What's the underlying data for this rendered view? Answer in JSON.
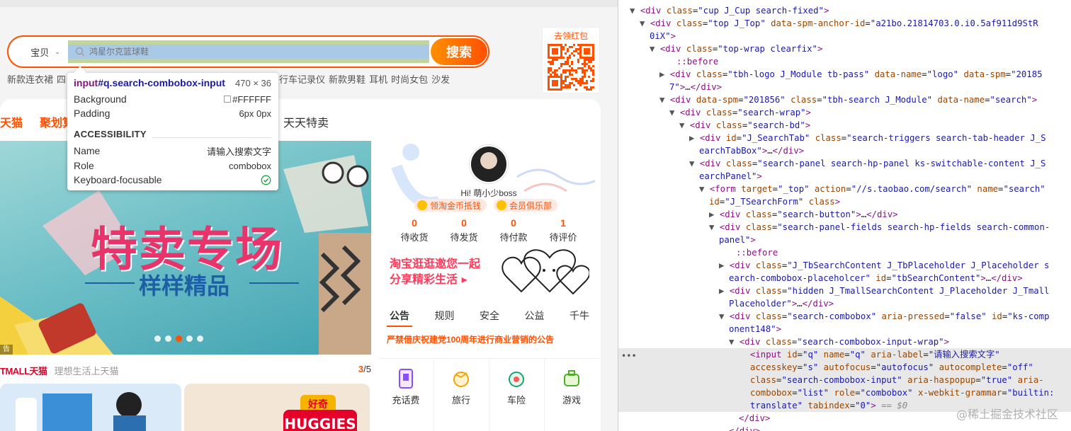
{
  "search": {
    "tab_label": "宝贝",
    "placeholder": "鸿星尔克篮球鞋",
    "button_label": "搜索",
    "hot_words": [
      "新款连衣裙",
      "四",
      "行车记录仪",
      "新款男鞋",
      "耳机",
      "时尚女包",
      "沙发"
    ]
  },
  "qr": {
    "title": "去领红包"
  },
  "channels": {
    "tmall": "天猫",
    "juhuasuan": "聚划算",
    "tiantian": "天天特卖"
  },
  "banner": {
    "title": "特卖专场",
    "subtitle": "样样精品",
    "tag": "告",
    "slide_count": 5,
    "active_slide": 3
  },
  "tmall": {
    "logo": "TMALL天猫",
    "slogan": "理想生活上天猫",
    "page_current": "3",
    "page_total": "/5",
    "brand1": "好奇",
    "brand2": "HUGGIES"
  },
  "user": {
    "greeting": "Hi! 萌小少boss",
    "coin_btn1": "领淘金币抵钱",
    "coin_btn2": "会员俱乐部",
    "stats": [
      {
        "num": "0",
        "label": "待收货"
      },
      {
        "num": "0",
        "label": "待发货"
      },
      {
        "num": "0",
        "label": "待付款"
      },
      {
        "num": "1",
        "label": "待评价"
      }
    ],
    "promo_line1": "淘宝逛逛邀您一起",
    "promo_line2": "分享精彩生活"
  },
  "notice": {
    "tabs": [
      "公告",
      "规则",
      "安全",
      "公益",
      "千牛"
    ],
    "text": "严禁借庆祝建党100周年进行商业营销的公告"
  },
  "services": [
    "充话费",
    "旅行",
    "车险",
    "游戏"
  ],
  "tooltip": {
    "selector_tag": "input",
    "selector_rest": "#q.search-combobox-input",
    "size": "470 × 36",
    "rows": [
      {
        "label": "Background",
        "value": "#FFFFFF"
      },
      {
        "label": "Padding",
        "value": "6px 0px"
      }
    ],
    "accessibility_heading": "ACCESSIBILITY",
    "a11y_rows": [
      {
        "label": "Name",
        "value": "请输入搜索文字"
      },
      {
        "label": "Role",
        "value": "combobox"
      },
      {
        "label": "Keyboard-focusable",
        "value": ""
      }
    ]
  },
  "colors": {
    "accent": "#ff5000",
    "devtools_tag": "#881280",
    "devtools_attr_name": "#994500",
    "devtools_attr_value": "#1a1aa6",
    "highlight_content": "#a9c9e6",
    "highlight_padding": "#c1d69d"
  },
  "devtools": {
    "lines": [
      {
        "indent": 30,
        "arrow": "▼",
        "html": "<span class='tag'>&lt;div</span> <span class='an'>class</span>=<span class='av'>\"cup J_Cup search-fixed\"</span><span class='tag'>&gt;</span>"
      },
      {
        "indent": 44,
        "arrow": "▼",
        "html": "<span class='tag'>&lt;div</span> <span class='an'>class</span>=<span class='av'>\"top J_Top\"</span> <span class='an'>data-spm-anchor-id</span>=<span class='av'>\"a21bo.21814703.0.i0.5af911d9StR</span>"
      },
      {
        "indent": 44,
        "arrow": "",
        "html": "<span class='av'>0iX\"</span><span class='tag'>&gt;</span>"
      },
      {
        "indent": 58,
        "arrow": "▼",
        "html": "<span class='tag'>&lt;div</span> <span class='an'>class</span>=<span class='av'>\"top-wrap clearfix\"</span><span class='tag'>&gt;</span>"
      },
      {
        "indent": 82,
        "arrow": "",
        "html": "<span class='pseudo'>::before</span>"
      },
      {
        "indent": 72,
        "arrow": "▶",
        "html": "<span class='tag'>&lt;div</span> <span class='an'>class</span>=<span class='av'>\"tbh-logo J_Module tb-pass\"</span> <span class='an'>data-name</span>=<span class='av'>\"logo\"</span> <span class='an'>data-spm</span>=<span class='av'>\"20185</span>"
      },
      {
        "indent": 72,
        "arrow": "",
        "html": "<span class='av'>7\"</span><span class='tag'>&gt;</span>…<span class='tag'>&lt;/div&gt;</span>"
      },
      {
        "indent": 72,
        "arrow": "▼",
        "html": "<span class='tag'>&lt;div</span> <span class='an'>data-spm</span>=<span class='av'>\"201856\"</span> <span class='an'>class</span>=<span class='av'>\"tbh-search J_Module\"</span> <span class='an'>data-name</span>=<span class='av'>\"search\"</span><span class='tag'>&gt;</span>"
      },
      {
        "indent": 86,
        "arrow": "▼",
        "html": "<span class='tag'>&lt;div</span> <span class='an'>class</span>=<span class='av'>\"search-wrap\"</span><span class='tag'>&gt;</span>"
      },
      {
        "indent": 100,
        "arrow": "▼",
        "html": "<span class='tag'>&lt;div</span> <span class='an'>class</span>=<span class='av'>\"search-bd\"</span><span class='tag'>&gt;</span>"
      },
      {
        "indent": 114,
        "arrow": "▶",
        "html": "<span class='tag'>&lt;div</span> <span class='an'>id</span>=<span class='av'>\"J_SearchTab\"</span> <span class='an'>class</span>=<span class='av'>\"search-triggers search-tab-header J_S</span>"
      },
      {
        "indent": 114,
        "arrow": "",
        "html": "<span class='av'>earchTabBox\"</span><span class='tag'>&gt;</span>…<span class='tag'>&lt;/div&gt;</span>"
      },
      {
        "indent": 114,
        "arrow": "▼",
        "html": "<span class='tag'>&lt;div</span> <span class='an'>class</span>=<span class='av'>\"search-panel search-hp-panel ks-switchable-content J_S</span>"
      },
      {
        "indent": 114,
        "arrow": "",
        "html": "<span class='av'>earchPanel\"</span><span class='tag'>&gt;</span>"
      },
      {
        "indent": 128,
        "arrow": "▼",
        "html": "<span class='tag'>&lt;form</span> <span class='an'>target</span>=<span class='av'>\"_top\"</span> <span class='an'>action</span>=<span class='av'>\"//s.taobao.com/search\"</span> <span class='an'>name</span>=<span class='av'>\"search\"</span>"
      },
      {
        "indent": 128,
        "arrow": "",
        "html": "<span class='an'>id</span>=<span class='av'>\"J_TSearchForm\"</span> <span class='an'>class</span><span class='tag'>&gt;</span>"
      },
      {
        "indent": 142,
        "arrow": "▶",
        "html": "<span class='tag'>&lt;div</span> <span class='an'>class</span>=<span class='av'>\"search-button\"</span><span class='tag'>&gt;</span>…<span class='tag'>&lt;/div&gt;</span>"
      },
      {
        "indent": 142,
        "arrow": "▼",
        "html": "<span class='tag'>&lt;div</span> <span class='an'>class</span>=<span class='av'>\"search-panel-fields search-hp-fields search-common-</span>"
      },
      {
        "indent": 142,
        "arrow": "",
        "html": "<span class='av'>panel\"</span><span class='tag'>&gt;</span>"
      },
      {
        "indent": 166,
        "arrow": "",
        "html": "<span class='pseudo'>::before</span>"
      },
      {
        "indent": 156,
        "arrow": "▶",
        "html": "<span class='tag'>&lt;div</span> <span class='an'>class</span>=<span class='av'>\"J_TbSearchContent J_TbPlaceholder J_Placeholder s</span>"
      },
      {
        "indent": 156,
        "arrow": "",
        "html": "<span class='av'>earch-combobox-placeholcer\"</span> <span class='an'>id</span>=<span class='av'>\"tbSearchContent\"</span><span class='tag'>&gt;</span>…<span class='tag'>&lt;/div&gt;</span>"
      },
      {
        "indent": 156,
        "arrow": "▶",
        "html": "<span class='tag'>&lt;div</span> <span class='an'>class</span>=<span class='av'>\"hidden J_TmallSearchContent J_Placeholder J_Tmall</span>"
      },
      {
        "indent": 156,
        "arrow": "",
        "html": "<span class='av'>Placeholder\"</span><span class='tag'>&gt;</span>…<span class='tag'>&lt;/div&gt;</span>"
      },
      {
        "indent": 156,
        "arrow": "▼",
        "html": "<span class='tag'>&lt;div</span> <span class='an'>class</span>=<span class='av'>\"search-combobox\"</span> <span class='an'>aria-pressed</span>=<span class='av'>\"false\"</span> <span class='an'>id</span>=<span class='av'>\"ks-comp</span>"
      },
      {
        "indent": 156,
        "arrow": "",
        "html": "<span class='av'>onent148\"</span><span class='tag'>&gt;</span>"
      },
      {
        "indent": 170,
        "arrow": "▼",
        "html": "<span class='tag'>&lt;div</span> <span class='an'>class</span>=<span class='av'>\"search-combobox-input-wrap\"</span><span class='tag'>&gt;</span>"
      },
      {
        "indent": 186,
        "arrow": "",
        "hl": true,
        "html": "<span class='tag'>&lt;input</span> <span class='an'>id</span>=<span class='av'>\"q\"</span> <span class='an'>name</span>=<span class='av'>\"q\"</span> <span class='an'>aria-label</span>=<span class='av'>\"请输入搜索文字\"</span>"
      },
      {
        "indent": 186,
        "arrow": "",
        "hl": true,
        "html": "<span class='an'>accesskey</span>=<span class='av'>\"s\"</span> <span class='an'>autofocus</span>=<span class='av'>\"autofocus\"</span> <span class='an'>autocomplete</span>=<span class='av'>\"off\"</span>"
      },
      {
        "indent": 186,
        "arrow": "",
        "hl": true,
        "html": "<span class='an'>class</span>=<span class='av'>\"search-combobox-input\"</span> <span class='an'>aria-haspopup</span>=<span class='av'>\"true\"</span> <span class='an'>aria-</span>"
      },
      {
        "indent": 186,
        "arrow": "",
        "hl": true,
        "html": "<span class='an'>combobox</span>=<span class='av'>\"list\"</span> <span class='an'>role</span>=<span class='av'>\"combobox\"</span> <span class='an'>x-webkit-grammar</span>=<span class='av'>\"builtin:</span>"
      },
      {
        "indent": 186,
        "arrow": "",
        "hl": true,
        "html": "<span class='av'>translate\"</span> <span class='an'>tabindex</span>=<span class='av'>\"0\"</span><span class='tag'>&gt;</span> <span class='eq'>== $0</span>"
      },
      {
        "indent": 170,
        "arrow": "",
        "html": "<span class='tag'>&lt;/div&gt;</span>"
      },
      {
        "indent": 156,
        "arrow": "",
        "html": "<span class='tag'>&lt;/div&gt;</span>"
      }
    ],
    "watermark": "@稀土掘金技术社区"
  }
}
